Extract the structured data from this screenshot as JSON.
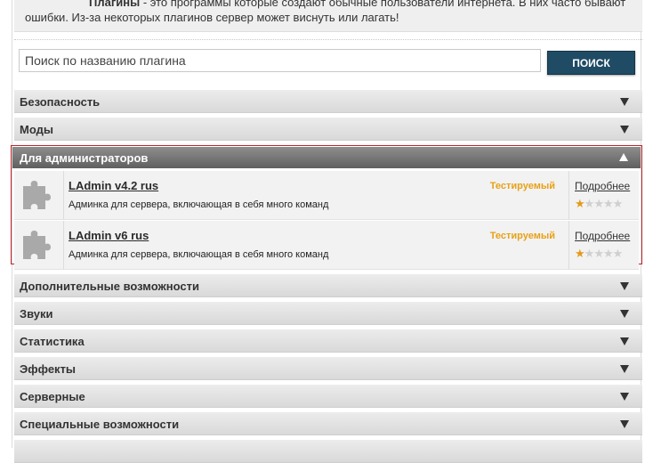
{
  "intro": {
    "lead": "Плагины",
    "text_after_lead": " - это программы которые создают обычные пользователи интернета. В них часто бывают",
    "line2": "ошибки. Из-за некоторых плагинов сервер может виснуть или лагать!"
  },
  "search": {
    "placeholder": "Поиск по названию плагина",
    "button_label": "ПОИСК"
  },
  "categories_top": [
    {
      "label": "Безопасность"
    },
    {
      "label": "Моды"
    }
  ],
  "open_category": {
    "label": "Для администраторов",
    "plugins": [
      {
        "name": "LAdmin v4.2 rus",
        "description": "Админка для сервера, включающая в себя много команд",
        "status": "Тестируемый",
        "more_label": "Подробнее",
        "rating": 0.5,
        "rating_max": 5
      },
      {
        "name": "LAdmin v6 rus",
        "description": "Админка для сервера, включающая в себя много команд",
        "status": "Тестируемый",
        "more_label": "Подробнее",
        "rating": 0.5,
        "rating_max": 5
      }
    ]
  },
  "categories_bottom": [
    {
      "label": "Дополнительные возможности"
    },
    {
      "label": "Звуки"
    },
    {
      "label": "Статистика"
    },
    {
      "label": "Эффекты"
    },
    {
      "label": "Серверные"
    },
    {
      "label": "Специальные возможности"
    }
  ],
  "colors": {
    "accent_button": "#1f4b65",
    "status": "#e8a117",
    "open_border": "#c0242b",
    "star_on": "#e39a1a"
  },
  "icons": {
    "plugin_icon": "puzzle-piece-icon",
    "collapsed_arrow": "triangle-down-icon",
    "expanded_arrow": "triangle-up-icon",
    "rating": "star-icon"
  }
}
